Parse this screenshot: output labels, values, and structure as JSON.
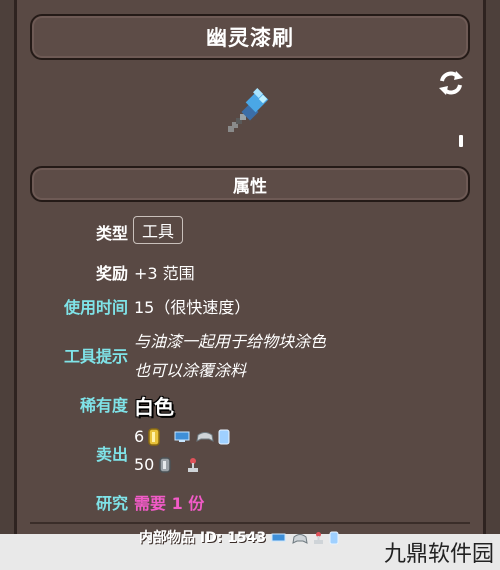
{
  "title": "幽灵漆刷",
  "section_title": "属性",
  "rows": {
    "type": {
      "label": "类型",
      "value": "工具"
    },
    "bonus": {
      "label": "奖励",
      "value": "+3 范围"
    },
    "use_time": {
      "label": "使用时间",
      "value": "15（很快速度）"
    },
    "tooltip": {
      "label": "工具提示",
      "line1": "与油漆一起用于给物块涂色",
      "line2": "也可以涂覆涂料"
    },
    "rarity": {
      "label": "稀有度",
      "value": "白色"
    },
    "sell": {
      "label": "卖出",
      "line1_value": "6",
      "line2_value": "50"
    },
    "research": {
      "label": "研究",
      "value": "需要 1 份"
    }
  },
  "footer": {
    "text": "内部物品 ID:  1543"
  },
  "watermark": "九鼎软件园",
  "icons": {
    "item": "paint-roller-icon",
    "refresh": "refresh-icon",
    "gold_coin": "gold-coin-icon",
    "silver_coin": "silver-coin-icon",
    "platforms": [
      "pc-icon",
      "console-icon",
      "mobile-icon",
      "joystick-icon"
    ]
  },
  "colors": {
    "label_cyan": "#7fe3e8",
    "research_pink": "#f25bc8",
    "panel": "#594944"
  }
}
